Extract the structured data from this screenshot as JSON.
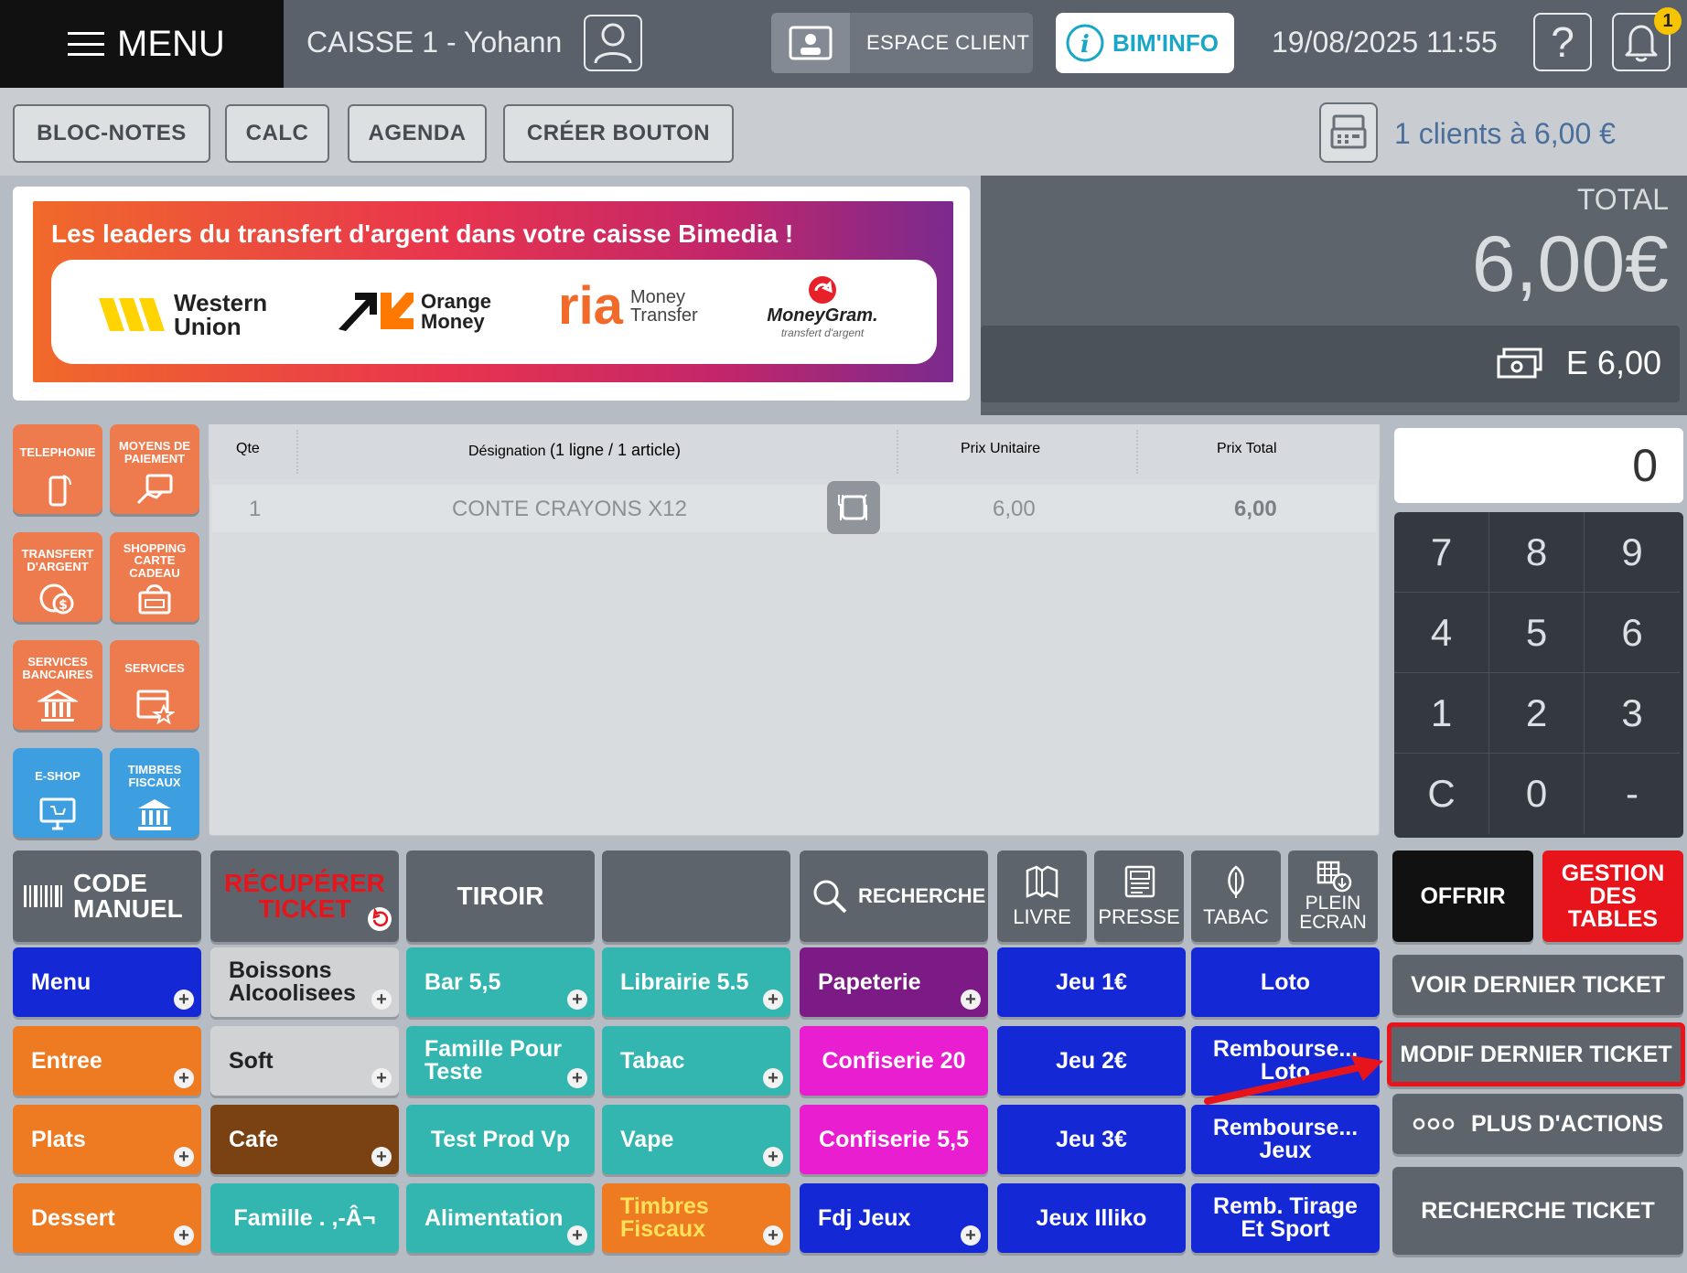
{
  "topbar": {
    "menu_label": "MENU",
    "caisse": "CAISSE 1 - Yohann",
    "espace_client": "ESPACE CLIENT",
    "bim_info": "BIM'INFO",
    "datetime": "19/08/2025 11:55",
    "help": "?",
    "notifications": "1"
  },
  "toolbar": {
    "bloc_notes": "BLOC-NOTES",
    "calc": "CALC",
    "agenda": "AGENDA",
    "creer_bouton": "CRÉER BOUTON",
    "clients": "1 clients à 6,00 €"
  },
  "banner": {
    "title": "Les leaders du transfert d'argent dans votre caisse Bimedia !",
    "logos": {
      "wu_line1": "Western",
      "wu_line2": "Union",
      "om_line1": "Orange",
      "om_line2": "Money",
      "ria": "ria",
      "ria_line1": "Money",
      "ria_line2": "Transfer",
      "mg": "MoneyGram.",
      "mg_sub": "transfert d'argent"
    }
  },
  "totals": {
    "label": "TOTAL",
    "value": "6,00€",
    "sub_value": "E 6,00"
  },
  "categories": [
    {
      "label": "TELEPHONIE",
      "color": "#ee7b4e"
    },
    {
      "label": "MOYENS DE PAIEMENT",
      "color": "#ee7b4e"
    },
    {
      "label": "TRANSFERT D'ARGENT",
      "color": "#ee7b4e"
    },
    {
      "label": "SHOPPING CARTE CADEAU",
      "color": "#ee7b4e"
    },
    {
      "label": "SERVICES BANCAIRES",
      "color": "#ee7b4e"
    },
    {
      "label": "SERVICES",
      "color": "#ee7b4e"
    },
    {
      "label": "E-SHOP",
      "color": "#3e9fe0"
    },
    {
      "label": "TIMBRES FISCAUX",
      "color": "#3e9fe0"
    }
  ],
  "table": {
    "headers": {
      "qte": "Qte",
      "designation": "Désignation",
      "designation_count": "(1 ligne / 1 article)",
      "prix_unitaire": "Prix Unitaire",
      "prix_total": "Prix Total"
    },
    "rows": [
      {
        "qte": "1",
        "designation": "CONTE CRAYONS X12",
        "prix_unitaire": "6,00",
        "prix_total": "6,00"
      }
    ]
  },
  "keypad": {
    "display": "0",
    "keys": [
      "7",
      "8",
      "9",
      "4",
      "5",
      "6",
      "1",
      "2",
      "3",
      "C",
      "0",
      "-"
    ]
  },
  "actions": {
    "code_manuel_1": "CODE",
    "code_manuel_2": "MANUEL",
    "recuperer_1": "RÉCUPÉRER",
    "recuperer_2": "TICKET",
    "tiroir": "TIROIR",
    "recherche": "RECHERCHE",
    "livre": "LIVRE",
    "presse": "PRESSE",
    "tabac": "TABAC",
    "plein_1": "PLEIN",
    "plein_2": "ECRAN",
    "offrir": "OFFRIR",
    "gestion_1": "GESTION",
    "gestion_2": "DES TABLES"
  },
  "products": [
    {
      "label": "Menu",
      "color": "#1428d6",
      "plus": true
    },
    {
      "label": "Boissons Alcoolisees",
      "color": "#d0d2d4",
      "dark": true,
      "plus": true
    },
    {
      "label": "Bar 5,5",
      "color": "#34b6b0",
      "plus": true
    },
    {
      "label": "Librairie 5.5",
      "color": "#34b6b0",
      "plus": true
    },
    {
      "label": "Papeterie",
      "color": "#7c1a86",
      "plus": true
    },
    {
      "label": "Jeu 1€",
      "color": "#1428d6",
      "center": true
    },
    {
      "label": "Loto",
      "color": "#1428d6",
      "center": true
    },
    {
      "label": "Entree",
      "color": "#ee7a22",
      "plus": true
    },
    {
      "label": "Soft",
      "color": "#d0d2d4",
      "dark": true,
      "plus": true
    },
    {
      "label": "Famille Pour Teste",
      "color": "#34b6b0",
      "plus": true
    },
    {
      "label": "Tabac",
      "color": "#34b6b0",
      "plus": true
    },
    {
      "label": "Confiserie 20",
      "color": "#e81ed0",
      "center": true
    },
    {
      "label": "Jeu 2€",
      "color": "#1428d6",
      "center": true
    },
    {
      "label": "Rembourse... Loto",
      "color": "#1428d6",
      "center": true
    },
    {
      "label": "Plats",
      "color": "#ee7a22",
      "plus": true
    },
    {
      "label": "Cafe",
      "color": "#7a4212",
      "plus": true
    },
    {
      "label": "Test Prod Vp",
      "color": "#34b6b0",
      "center": true
    },
    {
      "label": "Vape",
      "color": "#34b6b0",
      "plus": true
    },
    {
      "label": "Confiserie 5,5",
      "color": "#e81ed0",
      "center": true
    },
    {
      "label": "Jeu 3€",
      "color": "#1428d6",
      "center": true
    },
    {
      "label": "Rembourse... Jeux",
      "color": "#1428d6",
      "center": true
    },
    {
      "label": "Dessert",
      "color": "#ee7a22",
      "plus": true
    },
    {
      "label": "Famille . ,-Â¬",
      "color": "#34b6b0",
      "center": true
    },
    {
      "label": "Alimentation",
      "color": "#34b6b0",
      "plus": true
    },
    {
      "label": "Timbres Fiscaux",
      "color": "#ee7a22",
      "textColor": "#ffe15a",
      "plus": true
    },
    {
      "label": "Fdj Jeux",
      "color": "#1428d6",
      "plus": true
    },
    {
      "label": "Jeux Illiko",
      "color": "#1428d6",
      "center": true
    },
    {
      "label": "Remb. Tirage Et Sport",
      "color": "#1428d6",
      "center": true
    }
  ],
  "right_actions": {
    "voir_dernier": "VOIR DERNIER TICKET",
    "modif_dernier": "MODIF DERNIER TICKET",
    "plus_actions": "PLUS D'ACTIONS",
    "recherche_ticket": "RECHERCHE TICKET"
  },
  "colors": {
    "highlight": "#e8141c",
    "offrir": "#111111",
    "gestion": "#e8141c"
  }
}
